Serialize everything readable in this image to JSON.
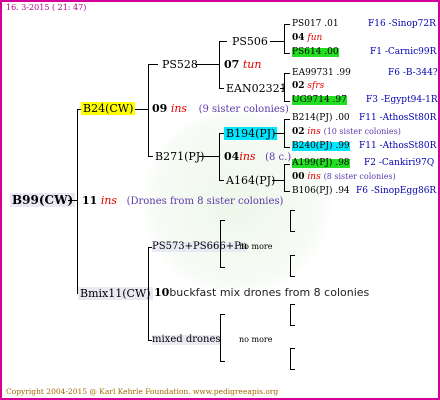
{
  "header": {
    "text": "16.  3-2015  ( 21: 47)"
  },
  "footer": {
    "text": "Copyright 2004-2015 @ Karl Kehrle Foundation.   www.pedigreeapis.org"
  },
  "root": {
    "name": "B99(CW)"
  },
  "gen1": {
    "mother": {
      "name": "B24(CW)"
    },
    "father_line": {
      "year": "11",
      "ins": "ins",
      "note": "(Drones from 8 sister colonies)"
    },
    "mother_mate": {
      "name": "Bmix11(CW)"
    },
    "mate_line": {
      "year": "10",
      "text": "buckfast mix drones from 8 colonies"
    }
  },
  "gen2": {
    "top_father": {
      "name": "PS528"
    },
    "year_line": {
      "year": "09",
      "ins": "ins",
      "note": "(9 sister colonies)"
    },
    "b271": {
      "name": "B271(PJ)"
    },
    "ps573": {
      "name": "PS573+PS666+Pn",
      "nomore": "no more"
    },
    "mixed": {
      "name": "mixed drones",
      "nomore": "no more"
    }
  },
  "gen3": {
    "ps506": {
      "name": "PS506"
    },
    "y07": {
      "year": "07",
      "ins": "tun"
    },
    "ean": {
      "name": "EAN02321"
    },
    "b194": {
      "name": "B194(PJ)"
    },
    "y04": {
      "year": "04",
      "ins": "ins",
      "note": "(8 c.)"
    },
    "a164": {
      "name": "A164(PJ)"
    }
  },
  "gen4": [
    {
      "name": "PS017 .01",
      "right": "F16 -Sinop72R"
    },
    {
      "year": "04",
      "ins": "fun"
    },
    {
      "name": "PS614 .00",
      "right": "F1 -Carnic99R",
      "hl": "g"
    },
    {
      "name": "EA99731 .99",
      "right": "F6 -B-344?"
    },
    {
      "year": "02",
      "ins": "sfrs"
    },
    {
      "name": "UG9714 .97",
      "right": "F3 -Egypt94-1R",
      "hl": "g"
    },
    {
      "name": "B214(PJ) .00",
      "right": "F11 -AthosSt80R"
    },
    {
      "year": "02",
      "ins": "ins",
      "note": "(10 sister colonies)"
    },
    {
      "name": "B240(PJ) .99",
      "right": "F11 -AthosSt80R",
      "hl": "c"
    },
    {
      "name": "A199(PJ) .98",
      "right": "F2 -Cankiri97Q",
      "hl": "g"
    },
    {
      "year": "00",
      "ins": "ins",
      "note": "(8 sister colonies)"
    },
    {
      "name": "B106(PJ) .94",
      "right": "F6 -SinopEgg86R"
    }
  ]
}
